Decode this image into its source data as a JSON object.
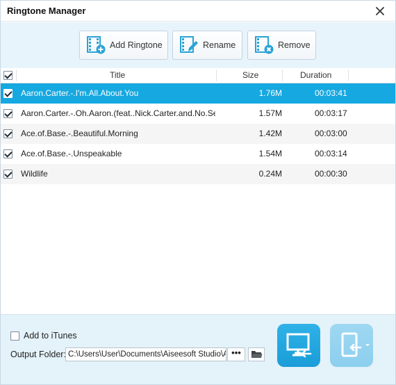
{
  "window": {
    "title": "Ringtone Manager"
  },
  "toolbar": {
    "add_label": "Add Ringtone",
    "rename_label": "Rename",
    "remove_label": "Remove"
  },
  "table": {
    "headers": {
      "title": "Title",
      "size": "Size",
      "duration": "Duration"
    },
    "select_all_checked": true,
    "rows": [
      {
        "title": "Aaron.Carter.-.I'm.All.About.You",
        "size": "1.76M",
        "duration": "00:03:41",
        "checked": true,
        "selected": true
      },
      {
        "title": "Aaron.Carter.-.Oh.Aaron.(feat..Nick.Carter.and.No.Sec...",
        "size": "1.57M",
        "duration": "00:03:17",
        "checked": true,
        "selected": false
      },
      {
        "title": "Ace.of.Base.-.Beautiful.Morning",
        "size": "1.42M",
        "duration": "00:03:00",
        "checked": true,
        "selected": false
      },
      {
        "title": "Ace.of.Base.-.Unspeakable",
        "size": "1.54M",
        "duration": "00:03:14",
        "checked": true,
        "selected": false
      },
      {
        "title": "Wildlife",
        "size": "0.24M",
        "duration": "00:00:30",
        "checked": true,
        "selected": false
      }
    ]
  },
  "footer": {
    "add_to_itunes_label": "Add to iTunes",
    "add_to_itunes_checked": false,
    "output_folder_label": "Output Folder:",
    "output_folder_value": "C:\\Users\\User\\Documents\\Aiseesoft Studio\\Aiseesoft",
    "browse_label": "•••"
  },
  "icons": {
    "close": "close-icon",
    "add": "film-add-icon",
    "rename": "film-rename-icon",
    "remove": "film-remove-icon",
    "folder": "folder-icon",
    "to_pc": "monitor-import-icon",
    "to_device": "phone-import-icon"
  },
  "colors": {
    "accent": "#16a8e0",
    "toolbar_bg": "#e8f4fb",
    "footer_bg": "#e4f2fa",
    "icon_blue": "#2aa3d6"
  }
}
